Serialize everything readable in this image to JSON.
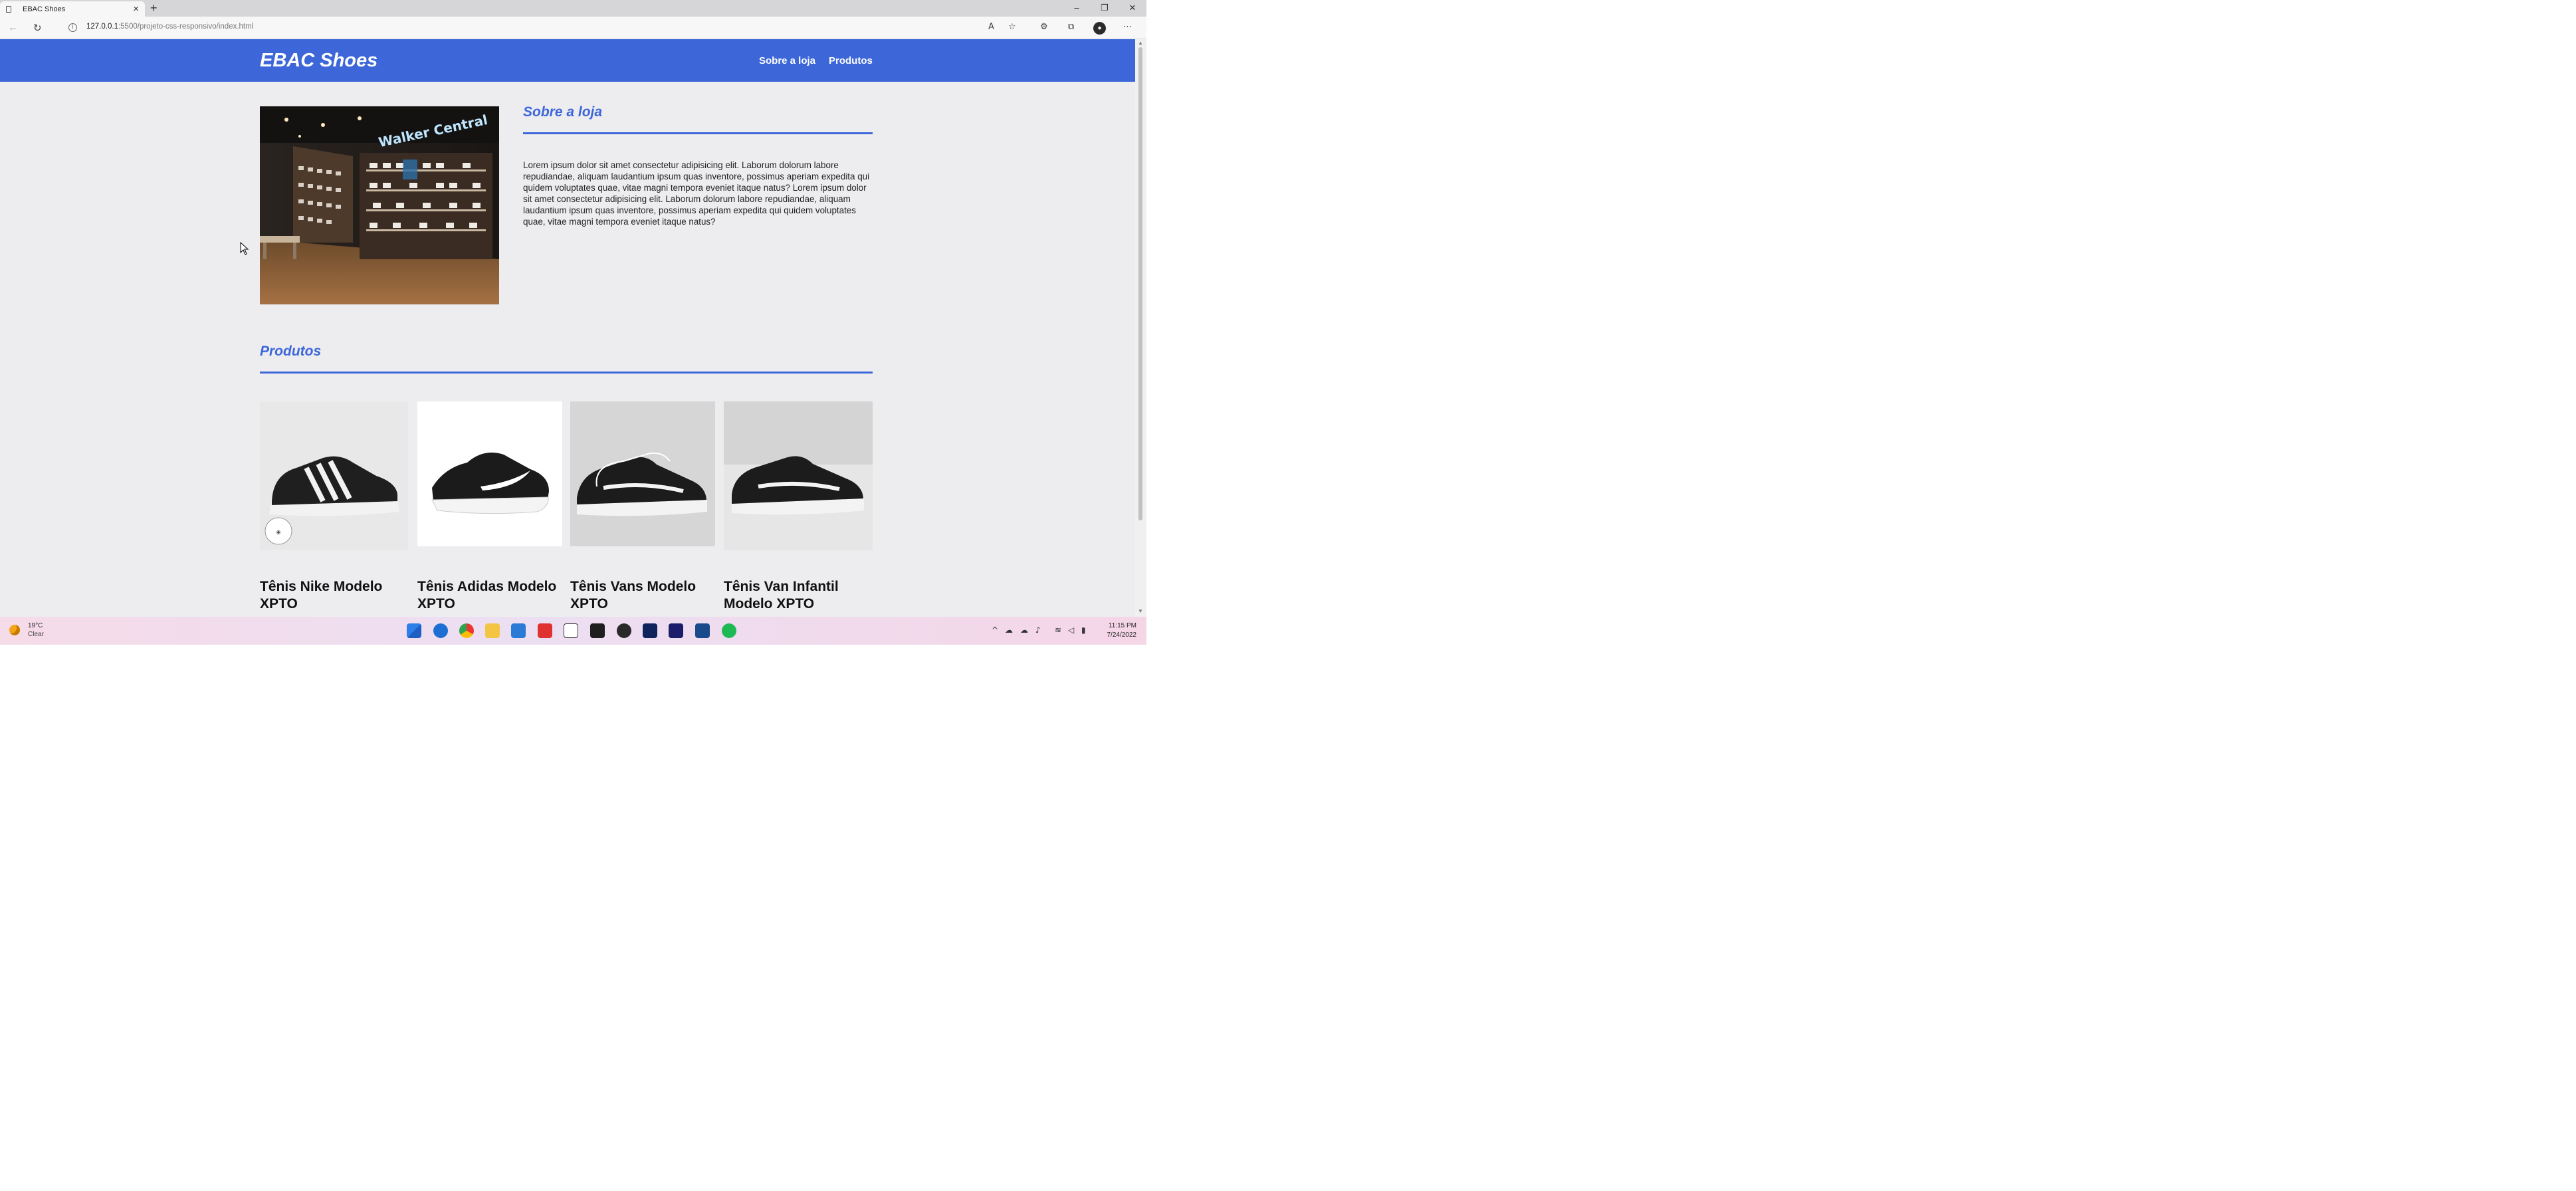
{
  "browser": {
    "tab_title": "EBAC Shoes",
    "url_host": "127.0.0.1",
    "url_path": ":5500/projeto-css-responsivo/index.html"
  },
  "site": {
    "logo": "EBAC Shoes",
    "nav": [
      "Sobre a loja",
      "Produtos"
    ],
    "about": {
      "title": "Sobre a loja",
      "text": "Lorem ipsum dolor sit amet consectetur adipisicing elit. Laborum dolorum labore repudiandae, aliquam laudantium ipsum quas inventore, possimus aperiam expedita qui quidem voluptates quae, vitae magni tempora eveniet itaque natus? Lorem ipsum dolor sit amet consectetur adipisicing elit. Laborum dolorum labore repudiandae, aliquam laudantium ipsum quas inventore, possimus aperiam expedita qui quidem voluptates quae, vitae magni tempora eveniet itaque natus?",
      "store_sign": "Walker Central"
    },
    "products_title": "Produtos",
    "products": [
      {
        "name": "Tênis Nike Modelo XPTO"
      },
      {
        "name": "Tênis Adidas Modelo XPTO"
      },
      {
        "name": "Tênis Vans Modelo XPTO"
      },
      {
        "name": "Tênis Van Infantil Modelo XPTO"
      }
    ]
  },
  "taskbar": {
    "temperature": "19°C",
    "condition": "Clear",
    "time": "11:15 PM",
    "date": "7/24/2022"
  },
  "colors": {
    "brand": "#3d67d9",
    "page_bg": "#ededf0"
  }
}
